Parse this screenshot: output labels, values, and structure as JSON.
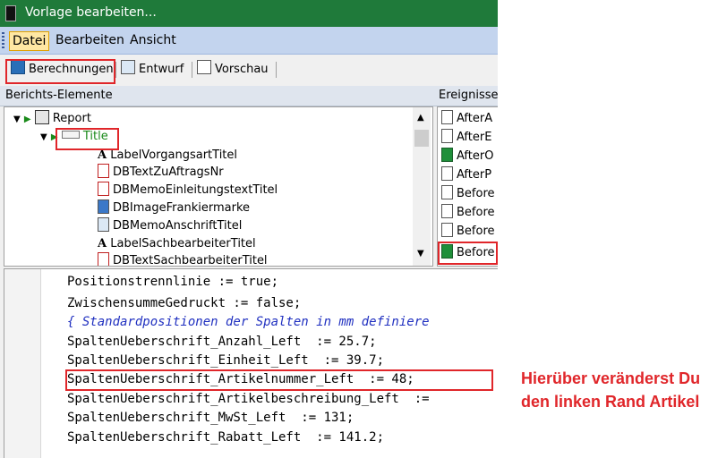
{
  "window": {
    "title": "Vorlage bearbeiten..."
  },
  "menu": {
    "items": [
      "Datei",
      "Bearbeiten",
      "Ansicht"
    ]
  },
  "tabs": [
    "Berechnungen",
    "Entwurf",
    "Vorschau"
  ],
  "panels": {
    "left_header": "Berichts-Elemente",
    "right_header": "Ereignisse"
  },
  "tree": {
    "items": [
      "Report",
      "Title",
      "LabelVorgangsartTitel",
      "DBTextZuAftragsNr",
      "DBMemoEinleitungstextTitel",
      "DBImageFrankiermarke",
      "DBMemoAnschriftTitel",
      "LabelSachbearbeiterTitel",
      "DBTextSachbearbeiterTitel"
    ]
  },
  "events": {
    "items": [
      "AfterA",
      "AfterE",
      "AfterO",
      "AfterP",
      "Before",
      "Before",
      "Before",
      "Before"
    ]
  },
  "code": {
    "lines": [
      "Positionstrennlinie := true;",
      "ZwischensummeGedruckt := false;",
      "{ Standardpositionen der Spalten in mm definiere",
      "SpaltenUeberschrift_Anzahl_Left  := 25.7;",
      "SpaltenUeberschrift_Einheit_Left  := 39.7;",
      "SpaltenUeberschrift_Artikelnummer_Left  := 48;",
      "SpaltenUeberschrift_Artikelbeschreibung_Left  :=",
      "SpaltenUeberschrift_MwSt_Left  := 131;",
      "SpaltenUeberschrift_Rabatt_Left  := 141.2;"
    ]
  },
  "annotation": {
    "line1": "Hierüber veränderst Du",
    "line2": "den linken Rand Artikel"
  },
  "colors": {
    "titlebar": "#1f7a3a",
    "menubar": "#c3d4ee",
    "highlight": "#e0262a",
    "comment": "#2030c0",
    "tree_title": "#1a8a1a"
  }
}
